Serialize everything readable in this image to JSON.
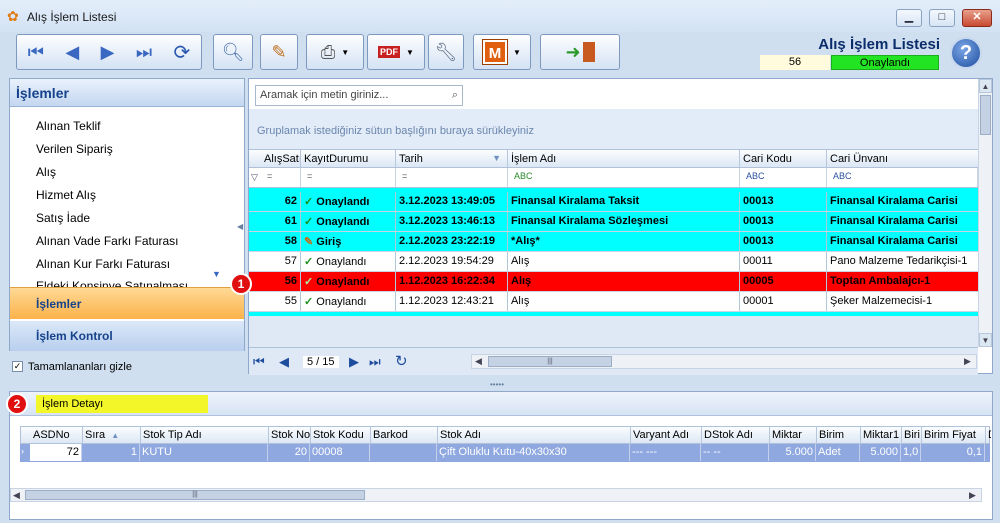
{
  "window": {
    "title": "Alış İşlem Listesi"
  },
  "header": {
    "title": "Alış İşlem Listesi",
    "record_no": "56",
    "record_status": "Onaylandı"
  },
  "toolbar": {
    "icons": [
      "first-icon",
      "prev-icon",
      "next-icon",
      "last-icon",
      "refresh-icon",
      "preview-icon",
      "edit-icon",
      "print-icon",
      "pdf-save-icon",
      "tools-icon",
      "m-icon",
      "exit-icon"
    ],
    "m_label": "M"
  },
  "left_panel": {
    "title": "İşlemler",
    "items": [
      "Alınan Teklif",
      "Verilen Sipariş",
      "Alış",
      "Hizmet Alış",
      "Satış İade",
      "Alınan Vade Farkı Faturası",
      "Alınan Kur Farkı Faturası",
      "Eldeki Konsinye Satınalması"
    ],
    "group_active": "İşlemler",
    "group_other": "İşlem Kontrol",
    "hide_completed": "Tamamlananları gizle"
  },
  "grid": {
    "search_placeholder": "Aramak için metin giriniz...",
    "group_hint": "Gruplamak istediğiniz sütun başlığını buraya sürükleyiniz",
    "columns": [
      "AlışSatış",
      "KayıtDurumu",
      "Tarih",
      "İşlem Adı",
      "Cari Kodu",
      "Cari Ünvanı"
    ],
    "filter_marks": [
      "=",
      "=",
      "=",
      "ABC",
      "ABC",
      "ABC"
    ],
    "rows": [
      {
        "no": "62",
        "status": "Onaylandı",
        "date": "3.12.2023 13:49:05",
        "name": "Finansal Kiralama Taksit",
        "code": "00013",
        "title": "Finansal Kiralama Carisi"
      },
      {
        "no": "61",
        "status": "Onaylandı",
        "date": "3.12.2023 13:46:13",
        "name": "Finansal Kiralama Sözleşmesi",
        "code": "00013",
        "title": "Finansal Kiralama Carisi"
      },
      {
        "no": "58",
        "status": "Giriş",
        "date": "2.12.2023 23:22:19",
        "name": "*Alış*",
        "code": "00013",
        "title": "Finansal Kiralama Carisi"
      },
      {
        "no": "57",
        "status": "Onaylandı",
        "date": "2.12.2023 19:54:29",
        "name": "Alış",
        "code": "00011",
        "title": "Pano Malzeme Tedarikçisi-1"
      },
      {
        "no": "56",
        "status": "Onaylandı",
        "date": "1.12.2023 16:22:34",
        "name": "Alış",
        "code": "00005",
        "title": "Toptan Ambalajcı-1"
      },
      {
        "no": "55",
        "status": "Onaylandı",
        "date": "1.12.2023 12:43:21",
        "name": "Alış",
        "code": "00001",
        "title": "Şeker Malzemecisi-1"
      }
    ],
    "page": "5 / 15"
  },
  "badges": {
    "one": "1",
    "two": "2"
  },
  "detail": {
    "title": "İşlem Detayı",
    "columns": [
      "ASDNo",
      "Sıra",
      "Stok Tip Adı",
      "Stok No",
      "Stok Kodu",
      "Barkod",
      "Stok Adı",
      "Varyant Adı",
      "DStok Adı",
      "Miktar",
      "Birim",
      "Miktar1",
      "Biri",
      "Birim Fiyat",
      "D"
    ],
    "row": [
      "72",
      "1",
      "KUTU",
      "20",
      "00008",
      "",
      "Çift Oluklu Kutu-40x30x30",
      "--- ---",
      "-- --",
      "5.000",
      "Adet",
      "5.000",
      "1,0",
      "0,1",
      ""
    ]
  },
  "colors": {
    "cyan_row": "#00ffff",
    "red_row": "#ff0000",
    "status_green": "#22e422",
    "title_blue": "#0c2d6b"
  }
}
